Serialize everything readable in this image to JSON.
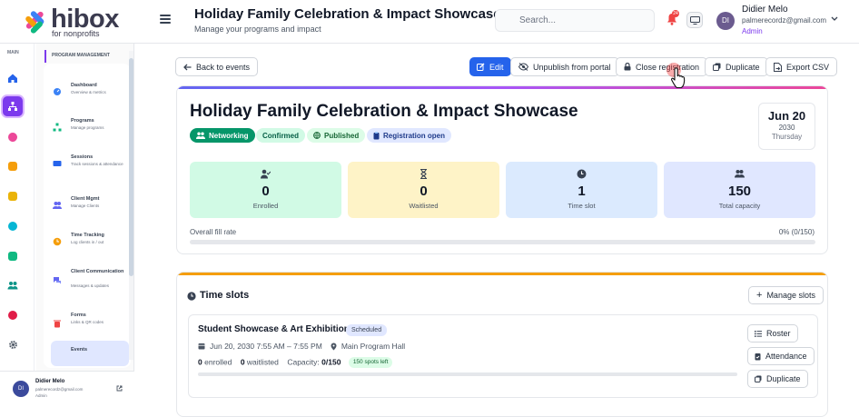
{
  "brand": {
    "name": "hibox",
    "tagline": "for nonprofits"
  },
  "header": {
    "title": "Holiday Family Celebration & Impact Showcase",
    "subtitle": "Manage your programs and impact",
    "search_placeholder": "Search...",
    "notifications_count": "24",
    "user": {
      "initials": "DI",
      "name": "Didier Melo",
      "email": "palmerecordz@gmail.com",
      "role": "Admin"
    }
  },
  "rail": {
    "label": "MAIN"
  },
  "submenu": {
    "heading": "PROGRAM MANAGEMENT",
    "items": [
      {
        "title": "Dashboard",
        "desc": "Overview & metrics"
      },
      {
        "title": "Programs",
        "desc": "Manage programs"
      },
      {
        "title": "Sessions",
        "desc": "Track sessions & attendance"
      },
      {
        "title": "Client Mgmt",
        "desc": "Manage Clients"
      },
      {
        "title": "Time Tracking",
        "desc": "Log clients in / out"
      },
      {
        "title": "Client Communication",
        "desc": "Messages & updates"
      },
      {
        "title": "Forms",
        "desc": "Links & QR codes"
      },
      {
        "title": "Events",
        "desc": ""
      }
    ]
  },
  "sidebar_user": {
    "initials": "DI",
    "name": "Didier Melo",
    "email": "palmerecordz@gmail.com",
    "role": "Admin"
  },
  "toolbar": {
    "back": "Back to events",
    "edit": "Edit",
    "unpublish": "Unpublish from portal",
    "close_registration": "Close registration",
    "duplicate": "Duplicate",
    "export": "Export CSV"
  },
  "event": {
    "title": "Holiday Family Celebration & Impact Showcase",
    "badges": [
      "Networking",
      "Confirmed",
      "Published",
      "Registration open"
    ],
    "date": {
      "month_day": "Jun 20",
      "year": "2030",
      "weekday": "Thursday"
    },
    "stats": [
      {
        "value": "0",
        "label": "Enrolled"
      },
      {
        "value": "0",
        "label": "Waitlisted"
      },
      {
        "value": "1",
        "label": "Time slot"
      },
      {
        "value": "150",
        "label": "Total capacity"
      }
    ],
    "fill_label": "Overall fill rate",
    "fill_value": "0% (0/150)",
    "fill_fraction": 0
  },
  "time_slots": {
    "title": "Time slots",
    "manage": "Manage slots",
    "slot": {
      "name": "Student Showcase & Art Exhibition",
      "status": "Scheduled",
      "datetime": "Jun 20, 2030 7:55 AM – 7:55 PM",
      "location": "Main Program Hall",
      "enrolled_num": "0",
      "enrolled_lbl": "enrolled",
      "waitlisted_num": "0",
      "waitlisted_lbl": "waitlisted",
      "capacity_lbl": "Capacity:",
      "capacity_val": "0/150",
      "spots": "150 spots left",
      "fill_fraction": 0,
      "actions": [
        "Roster",
        "Attendance",
        "Duplicate"
      ]
    }
  },
  "colors": {
    "accent": "#2563eb",
    "brand_purple": "#7c3aed",
    "enrolled_bg": "#d1fae5",
    "waitlisted_bg": "#fef3c7",
    "slot_bg": "#dbeafe",
    "capacity_bg": "#e0e7ff"
  }
}
